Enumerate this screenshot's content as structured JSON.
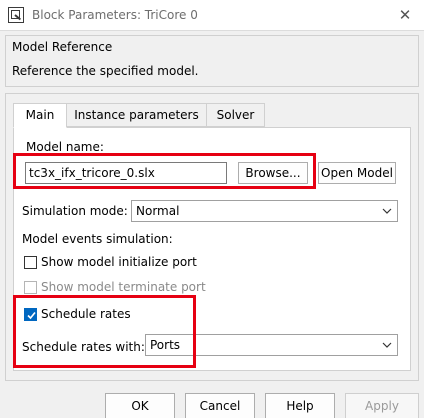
{
  "window": {
    "title": "Block Parameters: TriCore 0",
    "close_glyph": "✕"
  },
  "header": {
    "title": "Model Reference",
    "description": "Reference the specified model."
  },
  "tabs": [
    {
      "label": "Main",
      "active": true
    },
    {
      "label": "Instance parameters",
      "active": false
    },
    {
      "label": "Solver",
      "active": false
    }
  ],
  "main": {
    "model_name_label": "Model name:",
    "model_name_value": "tc3x_ifx_tricore_0.slx",
    "browse_label": "Browse...",
    "open_model_label": "Open Model",
    "simulation_mode_label": "Simulation mode:",
    "simulation_mode_value": "Normal",
    "model_events_label": "Model events simulation:",
    "show_init_port_label": "Show model initialize port",
    "show_init_port_checked": false,
    "show_term_port_label": "Show model terminate port",
    "show_term_port_checked": false,
    "schedule_rates_label": "Schedule rates",
    "schedule_rates_checked": true,
    "schedule_rates_with_label": "Schedule rates with:",
    "schedule_rates_with_value": "Ports"
  },
  "footer": {
    "ok_label": "OK",
    "cancel_label": "Cancel",
    "help_label": "Help",
    "apply_label": "Apply"
  },
  "colors": {
    "highlight": "#e60012",
    "checkbox_accent": "#0067c0"
  }
}
